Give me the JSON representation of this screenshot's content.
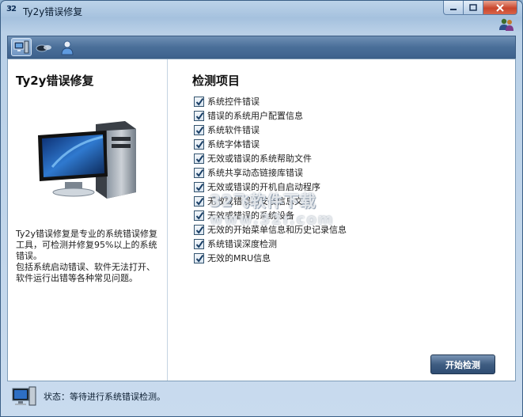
{
  "window": {
    "title": "Ty2y错误修复",
    "app_icon_text": "32"
  },
  "left": {
    "title": "Ty2y错误修复",
    "description": "Ty2y错误修复是专业的系统错误修复工具，可检测并修复95%以上的系统错误。\n包括系统启动错误、软件无法打开、软件运行出错等各种常见问题。"
  },
  "right": {
    "title": "检测项目",
    "items": [
      {
        "label": "系统控件错误",
        "checked": true
      },
      {
        "label": "错误的系统用户配置信息",
        "checked": true
      },
      {
        "label": "系统软件错误",
        "checked": true
      },
      {
        "label": "系统字体错误",
        "checked": true
      },
      {
        "label": "无效或错误的系统帮助文件",
        "checked": true
      },
      {
        "label": "系统共享动态链接库错误",
        "checked": true
      },
      {
        "label": "无效或错误的开机自启动程序",
        "checked": true
      },
      {
        "label": "无效或错误的安装信息文件",
        "checked": true
      },
      {
        "label": "无效或错误的系统设备",
        "checked": true
      },
      {
        "label": "无效的开始菜单信息和历史记录信息",
        "checked": true
      },
      {
        "label": "系统错误深度检测",
        "checked": true
      },
      {
        "label": "无效的MRU信息",
        "checked": true
      }
    ]
  },
  "buttons": {
    "start": "开始检测"
  },
  "status": {
    "text": "状态：等待进行系统错误检测。"
  },
  "watermark": {
    "line1": "32飞软件下载",
    "line2": "www.32r.com"
  },
  "colors": {
    "toolbar": "#4a6f99",
    "button": "#3f5d82",
    "frame": "#a5c1de"
  }
}
